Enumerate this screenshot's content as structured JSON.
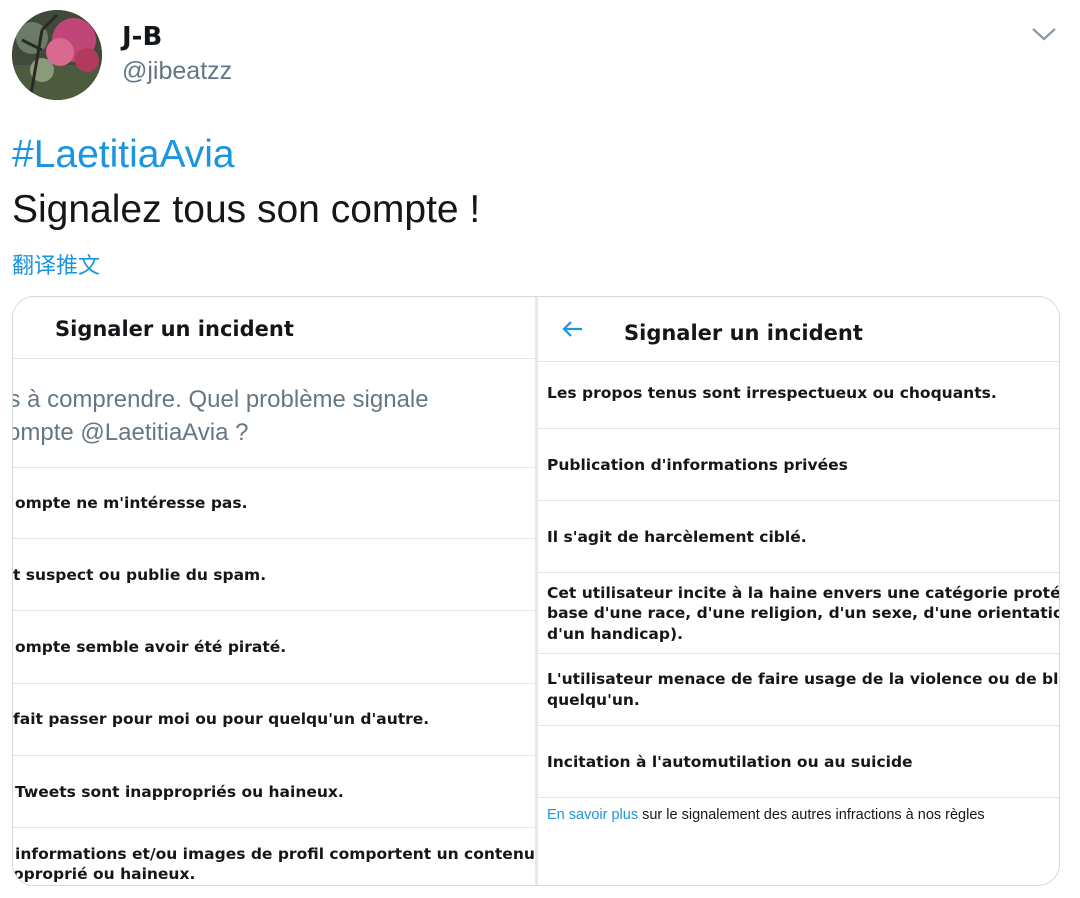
{
  "tweet": {
    "author": {
      "display_name": "J-B",
      "handle": "@jibeatzz",
      "avatar_icon": "profile-photo-autumn-trees"
    },
    "hashtag": "#LaetitiaAvia",
    "text": "Signalez tous son compte !",
    "translate_label": "翻译推文",
    "menu_icon": "chevron-down-icon"
  },
  "media": {
    "left": {
      "title": "Signaler un incident",
      "question_lines": [
        "ez-nous à comprendre. Quel problème signale",
        "et du compte @LaetitiaAvia ?"
      ],
      "options": [
        "ompte ne m'intéresse pas.",
        "t suspect ou publie du spam.",
        "ompte semble avoir été piraté.",
        " fait passer pour moi ou pour quelqu'un d'autre.",
        "Tweets sont inappropriés ou haineux.",
        "informations et/ou images de profil comportent un contenu",
        "oproprié ou haineux."
      ]
    },
    "right": {
      "title": "Signaler un incident",
      "back_icon": "arrow-left-icon",
      "options": [
        "Les propos tenus sont irrespectueux ou choquants.",
        "Publication d'informations privées",
        "Il s'agit de harcèlement ciblé.",
        "Cet utilisateur incite à la haine envers une catégorie protégé",
        "base d'une race, d'une religion, d'un sexe, d'une orientation",
        "d'un handicap).",
        "L'utilisateur menace de faire usage de la violence ou de bles",
        "quelqu'un.",
        "Incitation à l'automutilation ou au suicide"
      ],
      "learn_more_link": "En savoir plus",
      "learn_more_rest": " sur le signalement des autres infractions à nos règles"
    }
  },
  "colors": {
    "link": "#1b95e0",
    "text": "#14171a",
    "muted": "#657786",
    "border": "#e1e8ed"
  }
}
